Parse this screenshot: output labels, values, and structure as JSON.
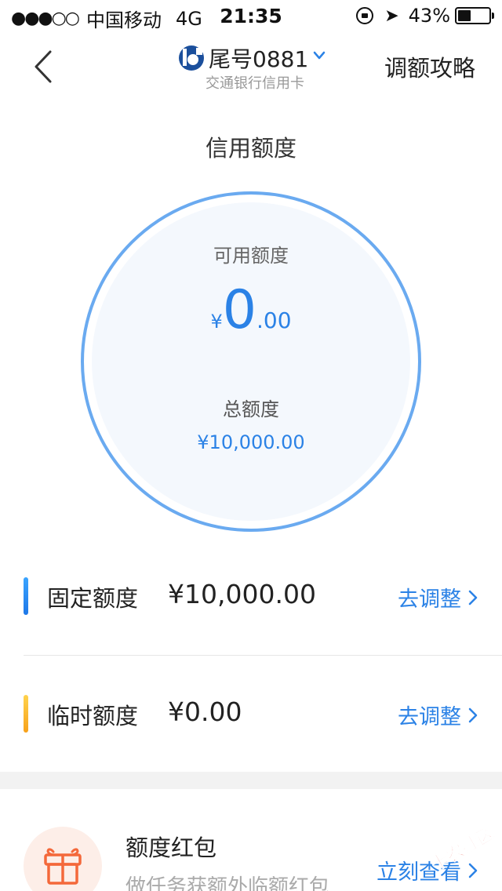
{
  "status_bar": {
    "signal_dots": "●●●○○",
    "carrier": "中国移动",
    "network": "4G",
    "time": "21:35",
    "battery_percent": "43%",
    "battery_level": 0.43
  },
  "nav": {
    "card_title": "尾号0881",
    "card_subtitle": "交通银行信用卡",
    "right_link": "调额攻略"
  },
  "credit": {
    "section_title": "信用额度",
    "available_label": "可用额度",
    "available_symbol": "¥",
    "available_integer": "0",
    "available_decimal": ".00",
    "total_label": "总额度",
    "total_amount": "¥10,000.00"
  },
  "limits": [
    {
      "label": "固定额度",
      "value": "¥10,000.00",
      "action": "去调整"
    },
    {
      "label": "临时额度",
      "value": "¥0.00",
      "action": "去调整"
    }
  ],
  "bonus": {
    "title": "额度红包",
    "description": "做任务获额外临额红包",
    "action": "立刻查看"
  },
  "watermark": {
    "text": "卡农社区"
  },
  "colors": {
    "accent_blue": "#2b82e6",
    "circle_border": "#6aaaf0",
    "bar_yellow": "#f7a11a",
    "gift_orange": "#f4683a"
  },
  "icons": {
    "back": "chevron-left-icon",
    "bank_logo": "bocom-logo-icon",
    "dropdown": "chevron-down-icon",
    "row_chevron": "chevron-right-icon",
    "gift": "gift-icon"
  }
}
